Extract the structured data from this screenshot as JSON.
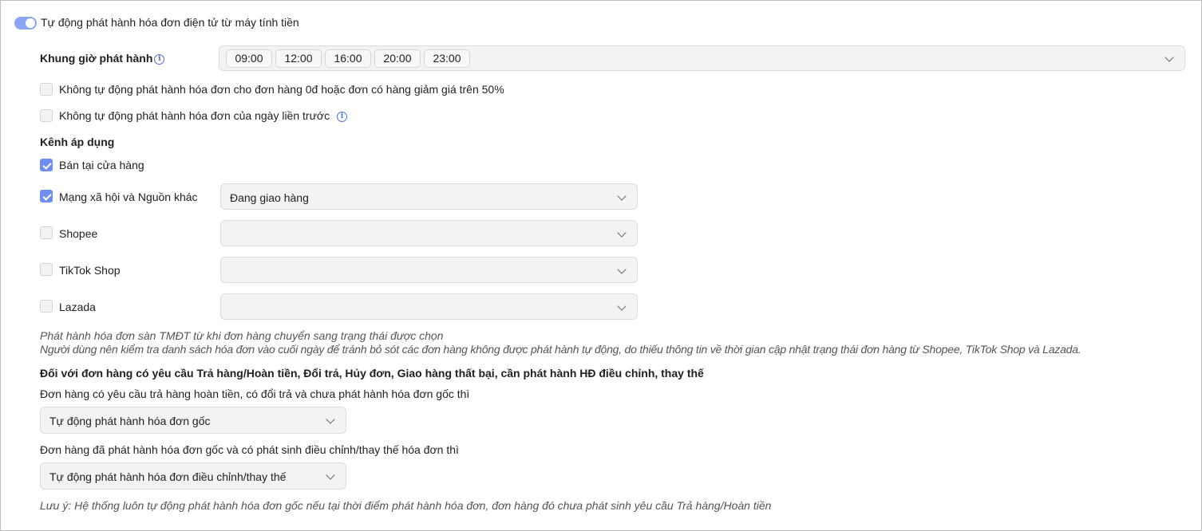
{
  "auto_issue": {
    "label": "Tự động phát hành hóa đơn điện tử từ máy tính tiền",
    "enabled": true
  },
  "time_slots": {
    "label": "Khung giờ phát hành",
    "info_icon": "info-icon",
    "tags": [
      "09:00",
      "12:00",
      "16:00",
      "20:00",
      "23:00"
    ]
  },
  "options": {
    "skip_zero": "Không tự động phát hành hóa đơn cho đơn hàng 0đ hoặc đơn có hàng giảm giá trên 50%",
    "skip_previous_day": "Không tự động phát hành hóa đơn của ngày liền trước"
  },
  "channels": {
    "title": "Kênh áp dụng",
    "store": {
      "label": "Bán tại cửa hàng",
      "checked": true
    },
    "social": {
      "label": "Mạng xã hội và Nguồn khác",
      "checked": true,
      "value": "Đang giao hàng"
    },
    "shopee": {
      "label": "Shopee",
      "checked": false,
      "value": ""
    },
    "tiktok": {
      "label": "TikTok Shop",
      "checked": false,
      "value": ""
    },
    "lazada": {
      "label": "Lazada",
      "checked": false,
      "value": ""
    },
    "note_line1": "Phát hành hóa đơn sàn TMĐT từ khi đơn hàng chuyển sang trạng thái được chọn",
    "note_line2": "Người dùng nên kiểm tra danh sách hóa đơn vào cuối ngày để tránh bỏ sót các đơn hàng không được phát hành tự động, do thiếu thông tin về thời gian cập nhật trạng thái đơn hàng từ Shopee, TikTok Shop và Lazada."
  },
  "adjustment": {
    "title": "Đối với đơn hàng có yêu cầu Trả hàng/Hoàn tiền, Đổi trả, Hủy đơn, Giao hàng thất bại, cần phát hành HĐ điều chỉnh, thay thế",
    "q1": "Đơn hàng có yêu cầu trả hàng hoàn tiền, có đổi trả và chưa phát hành hóa đơn gốc thì",
    "q1_value": "Tự động phát hành hóa đơn gốc",
    "q2": "Đơn hàng đã phát hành hóa đơn gốc và có phát sinh điều chỉnh/thay thế hóa đơn thì",
    "q2_value": "Tự động phát hành hóa đơn điều chỉnh/thay thế",
    "footnote": "Lưu ý: Hệ thống luôn tự động phát hành hóa đơn gốc nếu tại thời điểm phát hành hóa đơn, đơn hàng đó chưa phát sinh yêu cầu Trả hàng/Hoàn tiền"
  },
  "colors": {
    "accent": "#6f8ff0",
    "toggle": "#8aa6f4",
    "field_bg": "#f3f3f3"
  }
}
